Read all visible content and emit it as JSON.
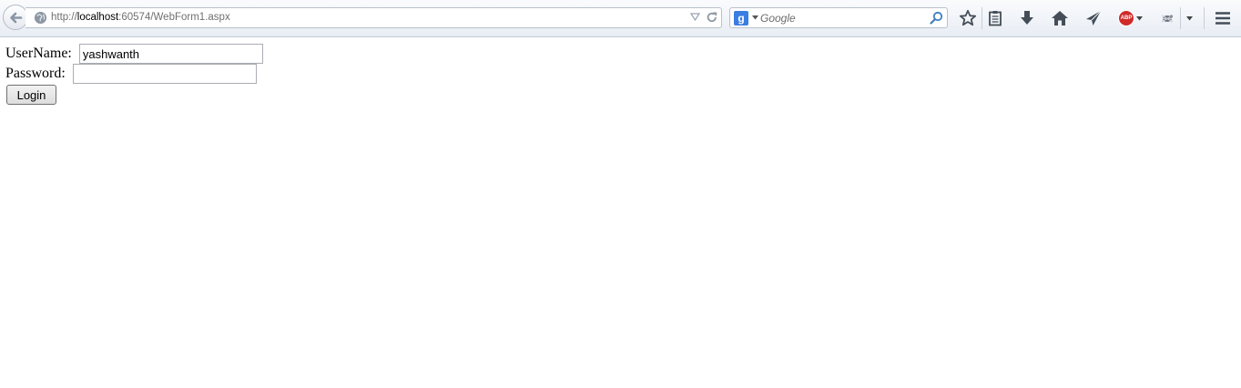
{
  "browser": {
    "url_prefix": "http://",
    "url_host": "localhost",
    "url_rest": ":60574/WebForm1.aspx",
    "search_engine_badge": "g",
    "search_placeholder": "Google",
    "addon_badge": "ABP"
  },
  "form": {
    "username_label": "UserName: ",
    "username_value": "yashwanth",
    "password_label": "Password: ",
    "password_value": "",
    "login_label": "Login"
  },
  "icons": {
    "back": "back-arrow-icon",
    "site": "globe-icon",
    "reload": "reload-icon",
    "search": "magnifier-icon",
    "bookmark": "star-icon",
    "reading_list": "clipboard-icon",
    "downloads": "download-arrow-icon",
    "home": "home-icon",
    "share": "paper-plane-icon",
    "menu": "hamburger-menu-icon"
  }
}
